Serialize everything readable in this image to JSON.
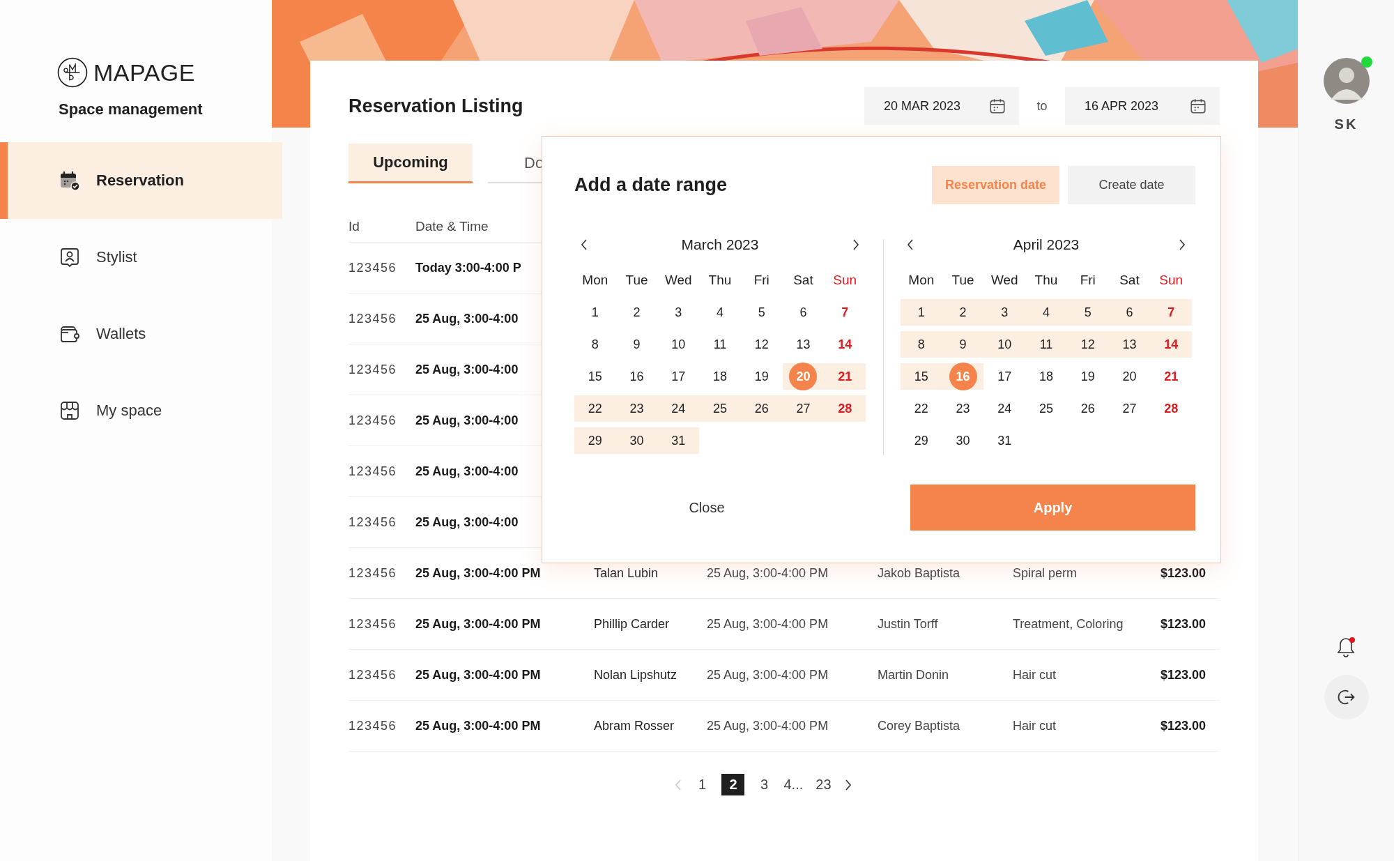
{
  "sidebar": {
    "logo": "MAPAGE",
    "subtitle": "Space management",
    "items": [
      {
        "label": "Reservation",
        "kind": "calendar",
        "selected": true
      },
      {
        "label": "Stylist",
        "kind": "person",
        "selected": false
      },
      {
        "label": "Wallets",
        "kind": "wallet",
        "selected": false
      },
      {
        "label": "My space",
        "kind": "store",
        "selected": false
      }
    ]
  },
  "listing": {
    "title": "Reservation Listing",
    "date_from": "20 MAR 2023",
    "to_label": "to",
    "date_to": "16 APR 2023",
    "tabs": [
      {
        "label": "Upcoming",
        "selected": true
      },
      {
        "label": "Do",
        "selected": false
      }
    ],
    "columns": [
      "Id",
      "Date & Time"
    ],
    "rows": [
      {
        "cells": [
          "123456",
          "Today 3:00-4:00 P"
        ]
      },
      {
        "cells": [
          "123456",
          "25 Aug, 3:00-4:00"
        ]
      },
      {
        "cells": [
          "123456",
          "25 Aug, 3:00-4:00"
        ]
      },
      {
        "cells": [
          "123456",
          "25 Aug, 3:00-4:00"
        ]
      },
      {
        "cells": [
          "123456",
          "25 Aug, 3:00-4:00"
        ]
      },
      {
        "cells": [
          "123456",
          "25 Aug, 3:00-4:00"
        ]
      },
      {
        "cells": [
          "123456",
          "25 Aug, 3:00-4:00 PM",
          "Talan Lubin",
          "25 Aug, 3:00-4:00 PM",
          "Jakob Baptista",
          "Spiral perm",
          "$123.00"
        ]
      },
      {
        "cells": [
          "123456",
          "25 Aug, 3:00-4:00 PM",
          "Phillip Carder",
          "25 Aug, 3:00-4:00 PM",
          "Justin Torff",
          "Treatment, Coloring",
          "$123.00"
        ]
      },
      {
        "cells": [
          "123456",
          "25 Aug, 3:00-4:00 PM",
          "Nolan Lipshutz",
          "25 Aug, 3:00-4:00 PM",
          "Martin Donin",
          "Hair cut",
          "$123.00"
        ]
      },
      {
        "cells": [
          "123456",
          "25 Aug, 3:00-4:00 PM",
          "Abram Rosser",
          "25 Aug, 3:00-4:00 PM",
          "Corey Baptista",
          "Hair cut",
          "$123.00"
        ]
      }
    ],
    "pagination": {
      "prev_disabled": true,
      "next_disabled": false,
      "pages": [
        {
          "label": "1",
          "selected": false
        },
        {
          "label": "2",
          "selected": true
        },
        {
          "label": "3",
          "selected": false
        },
        {
          "label": "4...",
          "selected": false
        },
        {
          "label": "23",
          "selected": false
        }
      ]
    }
  },
  "date_picker": {
    "title": "Add a date range",
    "modes": [
      {
        "label": "Reservation date",
        "selected": true
      },
      {
        "label": "Create date",
        "selected": false
      }
    ],
    "months": [
      {
        "title": "March 2023",
        "weekdays": [
          "Mon",
          "Tue",
          "Wed",
          "Thu",
          "Fri",
          "Sat",
          "Sun"
        ],
        "weeks": [
          [
            {
              "label": "1",
              "in_range": false,
              "selected": false
            },
            {
              "label": "2",
              "in_range": false,
              "selected": false
            },
            {
              "label": "3",
              "in_range": false,
              "selected": false
            },
            {
              "label": "4",
              "in_range": false,
              "selected": false
            },
            {
              "label": "5",
              "in_range": false,
              "selected": false
            },
            {
              "label": "6",
              "in_range": false,
              "selected": false
            },
            {
              "label": "7",
              "in_range": false,
              "selected": false
            }
          ],
          [
            {
              "label": "8",
              "in_range": false,
              "selected": false
            },
            {
              "label": "9",
              "in_range": false,
              "selected": false
            },
            {
              "label": "10",
              "in_range": false,
              "selected": false
            },
            {
              "label": "11",
              "in_range": false,
              "selected": false
            },
            {
              "label": "12",
              "in_range": false,
              "selected": false
            },
            {
              "label": "13",
              "in_range": false,
              "selected": false
            },
            {
              "label": "14",
              "in_range": false,
              "selected": false
            }
          ],
          [
            {
              "label": "15",
              "in_range": false,
              "selected": false
            },
            {
              "label": "16",
              "in_range": false,
              "selected": false
            },
            {
              "label": "17",
              "in_range": false,
              "selected": false
            },
            {
              "label": "18",
              "in_range": false,
              "selected": false
            },
            {
              "label": "19",
              "in_range": false,
              "selected": false
            },
            {
              "label": "20",
              "in_range": true,
              "selected": true
            },
            {
              "label": "21",
              "in_range": true,
              "selected": false
            }
          ],
          [
            {
              "label": "22",
              "in_range": true,
              "selected": false
            },
            {
              "label": "23",
              "in_range": true,
              "selected": false
            },
            {
              "label": "24",
              "in_range": true,
              "selected": false
            },
            {
              "label": "25",
              "in_range": true,
              "selected": false
            },
            {
              "label": "26",
              "in_range": true,
              "selected": false
            },
            {
              "label": "27",
              "in_range": true,
              "selected": false
            },
            {
              "label": "28",
              "in_range": true,
              "selected": false
            }
          ],
          [
            {
              "label": "29",
              "in_range": true,
              "selected": false
            },
            {
              "label": "30",
              "in_range": true,
              "selected": false
            },
            {
              "label": "31",
              "in_range": true,
              "selected": false
            }
          ]
        ]
      },
      {
        "title": "April 2023",
        "weekdays": [
          "Mon",
          "Tue",
          "Wed",
          "Thu",
          "Fri",
          "Sat",
          "Sun"
        ],
        "weeks": [
          [
            {
              "label": "1",
              "in_range": true,
              "selected": false
            },
            {
              "label": "2",
              "in_range": true,
              "selected": false
            },
            {
              "label": "3",
              "in_range": true,
              "selected": false
            },
            {
              "label": "4",
              "in_range": true,
              "selected": false
            },
            {
              "label": "5",
              "in_range": true,
              "selected": false
            },
            {
              "label": "6",
              "in_range": true,
              "selected": false
            },
            {
              "label": "7",
              "in_range": true,
              "selected": false
            }
          ],
          [
            {
              "label": "8",
              "in_range": true,
              "selected": false
            },
            {
              "label": "9",
              "in_range": true,
              "selected": false
            },
            {
              "label": "10",
              "in_range": true,
              "selected": false
            },
            {
              "label": "11",
              "in_range": true,
              "selected": false
            },
            {
              "label": "12",
              "in_range": true,
              "selected": false
            },
            {
              "label": "13",
              "in_range": true,
              "selected": false
            },
            {
              "label": "14",
              "in_range": true,
              "selected": false
            }
          ],
          [
            {
              "label": "15",
              "in_range": true,
              "selected": false
            },
            {
              "label": "16",
              "in_range": true,
              "selected": true
            },
            {
              "label": "17",
              "in_range": false,
              "selected": false
            },
            {
              "label": "18",
              "in_range": false,
              "selected": false
            },
            {
              "label": "19",
              "in_range": false,
              "selected": false
            },
            {
              "label": "20",
              "in_range": false,
              "selected": false
            },
            {
              "label": "21",
              "in_range": false,
              "selected": false
            }
          ],
          [
            {
              "label": "22",
              "in_range": false,
              "selected": false
            },
            {
              "label": "23",
              "in_range": false,
              "selected": false
            },
            {
              "label": "24",
              "in_range": false,
              "selected": false
            },
            {
              "label": "25",
              "in_range": false,
              "selected": false
            },
            {
              "label": "26",
              "in_range": false,
              "selected": false
            },
            {
              "label": "27",
              "in_range": false,
              "selected": false
            },
            {
              "label": "28",
              "in_range": false,
              "selected": false
            }
          ],
          [
            {
              "label": "29",
              "in_range": false,
              "selected": false
            },
            {
              "label": "30",
              "in_range": false,
              "selected": false
            },
            {
              "label": "31",
              "in_range": false,
              "selected": false
            }
          ]
        ]
      }
    ],
    "close": "Close",
    "apply": "Apply"
  },
  "user": {
    "initials": "SK",
    "online": true
  },
  "notifications": {
    "unread": true
  }
}
